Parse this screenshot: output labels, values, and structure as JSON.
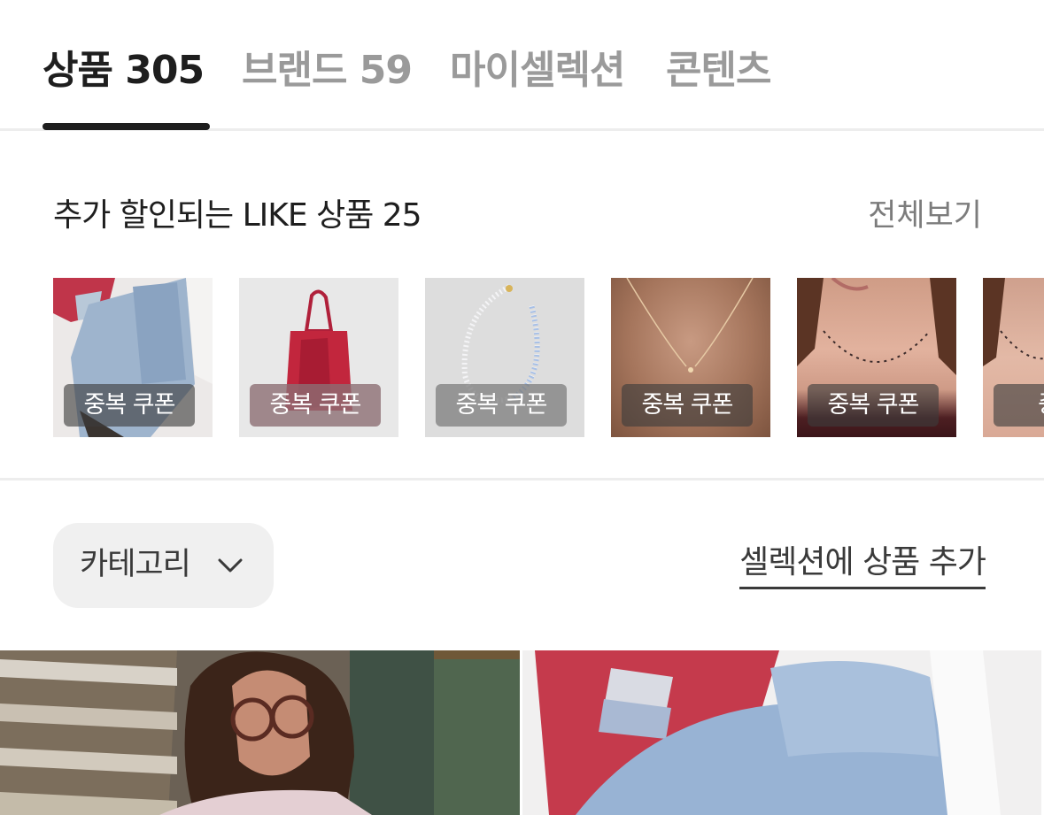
{
  "tabs": [
    {
      "label": "상품 305",
      "active": true
    },
    {
      "label": "브랜드 59",
      "active": false
    },
    {
      "label": "마이셀렉션",
      "active": false
    },
    {
      "label": "콘텐츠",
      "active": false
    }
  ],
  "like_section": {
    "title": "추가 할인되는 LIKE 상품 25",
    "view_all": "전체보기",
    "items": [
      {
        "badge": "중복 쿠폰"
      },
      {
        "badge": "중복 쿠폰"
      },
      {
        "badge": "중복 쿠폰"
      },
      {
        "badge": "중복 쿠폰"
      },
      {
        "badge": "중복 쿠폰"
      },
      {
        "badge": "중복"
      }
    ]
  },
  "filter": {
    "category_label": "카테고리",
    "add_to_selection": "셀렉션에 상품 추가"
  },
  "icons": {
    "category_dropdown": "chevron-down-icon"
  },
  "colors": {
    "active_tab": "#1e1e1e",
    "inactive_tab": "#9a9a9a",
    "divider": "#ededed",
    "category_pill": "#f0f0f0"
  }
}
